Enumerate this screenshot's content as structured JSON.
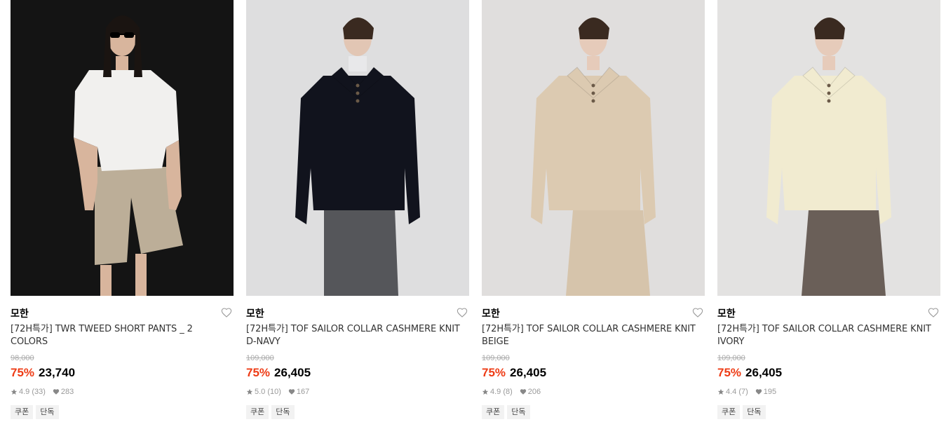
{
  "products": [
    {
      "brand": "모한",
      "title_line1": "[72H특가] TWR TWEED SHORT PANTS _ 2",
      "title_line2": "COLORS",
      "original_price": "98,000",
      "discount": "75%",
      "price": "23,740",
      "rating": "4.9 (33)",
      "likes": "283",
      "tags": [
        "쿠폰",
        "단독"
      ],
      "image": {
        "bg": "#141414",
        "top": "#f1f0ee",
        "bottom": "#bcae98",
        "skin": "#d8b59d",
        "hair": "#1a1411"
      }
    },
    {
      "brand": "모한",
      "title_line1": "[72H특가] TOF SAILOR COLLAR CASHMERE KNIT",
      "title_line2": "D-NAVY",
      "original_price": "109,000",
      "discount": "75%",
      "price": "26,405",
      "rating": "5.0 (10)",
      "likes": "167",
      "tags": [
        "쿠폰",
        "단독"
      ],
      "image": {
        "bg": "#dededf",
        "top": "#11131d",
        "bottom": "#55565a",
        "skin": "#e2c6b4",
        "hair": "#3a2a20"
      }
    },
    {
      "brand": "모한",
      "title_line1": "[72H특가] TOF SAILOR COLLAR CASHMERE KNIT",
      "title_line2": "BEIGE",
      "original_price": "109,000",
      "discount": "75%",
      "price": "26,405",
      "rating": "4.9 (8)",
      "likes": "206",
      "tags": [
        "쿠폰",
        "단독"
      ],
      "image": {
        "bg": "#e0dedd",
        "top": "#dccab1",
        "bottom": "#d6c4ab",
        "skin": "#e6cbba",
        "hair": "#3a2a20"
      }
    },
    {
      "brand": "모한",
      "title_line1": "[72H특가] TOF SAILOR COLLAR CASHMERE KNIT",
      "title_line2": "IVORY",
      "original_price": "109,000",
      "discount": "75%",
      "price": "26,405",
      "rating": "4.4 (7)",
      "likes": "195",
      "tags": [
        "쿠폰",
        "단독"
      ],
      "image": {
        "bg": "#e3e2e1",
        "top": "#f1ebd0",
        "bottom": "#6a5f58",
        "skin": "#e6cbba",
        "hair": "#3a2a20"
      }
    }
  ],
  "colors": {
    "discount": "#ee3c16",
    "tag_bg": "#f2f2f2"
  },
  "icons": {
    "heart": "heart-outline-icon",
    "star": "star-icon",
    "like": "heart-filled-icon"
  }
}
